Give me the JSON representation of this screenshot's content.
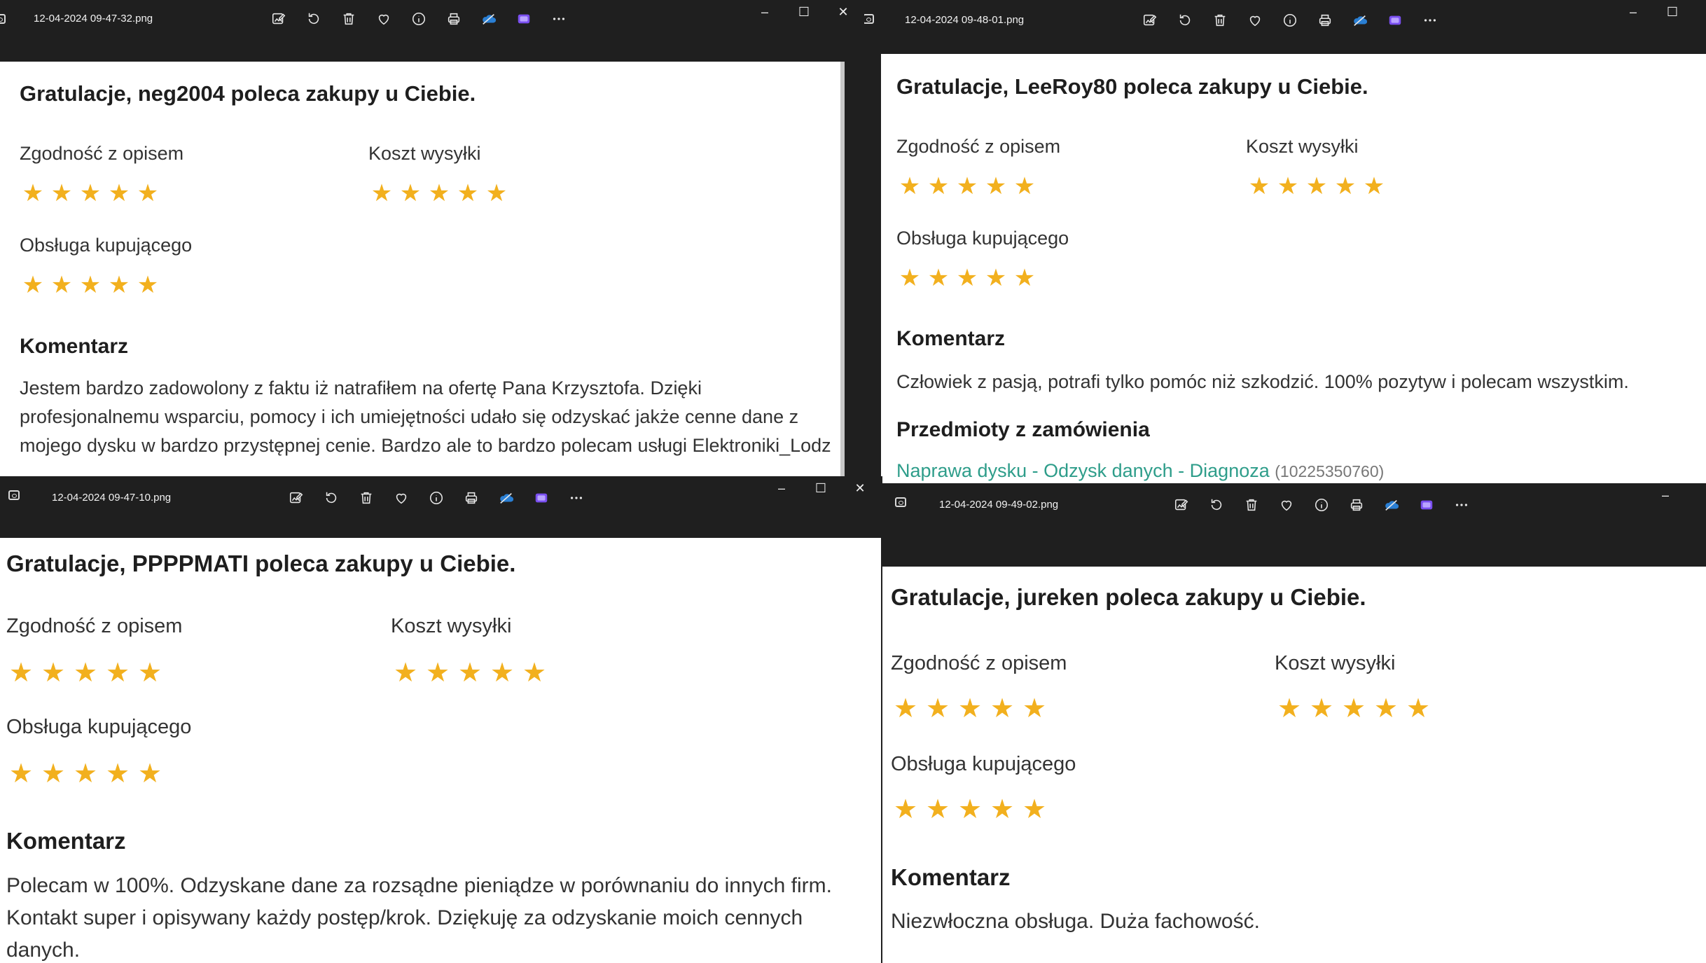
{
  "windows": [
    {
      "filename": "12-04-2024 09-47-32.png",
      "title": "Gratulacje, neg2004 poleca zakupy u Ciebie.",
      "ratings": {
        "desc_label": "Zgodność z opisem",
        "desc": 5,
        "ship_label": "Koszt wysyłki",
        "ship": 5,
        "service_label": "Obsługa kupującego",
        "service": 5
      },
      "comment_heading": "Komentarz",
      "comment": "Jestem bardzo zadowolony z faktu iż natrafiłem na ofertę Pana Krzysztofa. Dzięki profesjonalnemu wsparciu, pomocy i ich umiejętności udało się odzyskać jakże cenne dane z mojego dysku w bardzo przystępnej cenie. Bardzo ale to bardzo polecam usługi Elektroniki_Lodz"
    },
    {
      "filename": "12-04-2024 09-48-01.png",
      "title": "Gratulacje, LeeRoy80 poleca zakupy u Ciebie.",
      "ratings": {
        "desc_label": "Zgodność z opisem",
        "desc": 5,
        "ship_label": "Koszt wysyłki",
        "ship": 5,
        "service_label": "Obsługa kupującego",
        "service": 5
      },
      "comment_heading": "Komentarz",
      "comment": "Człowiek z pasją, potrafi tylko pomóc niż szkodzić. 100% pozytyw i polecam wszystkim.",
      "items_heading": "Przedmioty z zamówienia",
      "item_link": "Naprawa dysku - Odzysk danych - Diagnoza",
      "item_id": "(10225350760)"
    },
    {
      "filename": "12-04-2024 09-47-10.png",
      "title": "Gratulacje, PPPPMATI poleca zakupy u Ciebie.",
      "ratings": {
        "desc_label": "Zgodność z opisem",
        "desc": 5,
        "ship_label": "Koszt wysyłki",
        "ship": 5,
        "service_label": "Obsługa kupującego",
        "service": 5
      },
      "comment_heading": "Komentarz",
      "comment": "Polecam w 100%. Odzyskane dane za rozsądne pieniądze w porównaniu do innych firm. Kontakt super i opisywany każdy postęp/krok. Dziękuję za odzyskanie moich cennych danych."
    },
    {
      "filename": "12-04-2024 09-49-02.png",
      "title": "Gratulacje, jureken poleca zakupy u Ciebie.",
      "ratings": {
        "desc_label": "Zgodność z opisem",
        "desc": 5,
        "ship_label": "Koszt wysyłki",
        "ship": 5,
        "service_label": "Obsługa kupującego",
        "service": 5
      },
      "comment_heading": "Komentarz",
      "comment": "Niezwłoczna obsługa. Duża fachowość."
    }
  ],
  "toolbar_icons": [
    "edit-image-icon",
    "rotate-icon",
    "delete-icon",
    "favorite-icon",
    "info-icon",
    "print-icon",
    "onedrive-icon",
    "clipchamp-icon",
    "more-icon"
  ],
  "window_controls": {
    "minimize": "–",
    "maximize": "☐",
    "close": "✕"
  },
  "colors": {
    "titlebar": "#1f1f1f",
    "star": "#f2b01e",
    "link": "#2e9d8a"
  }
}
